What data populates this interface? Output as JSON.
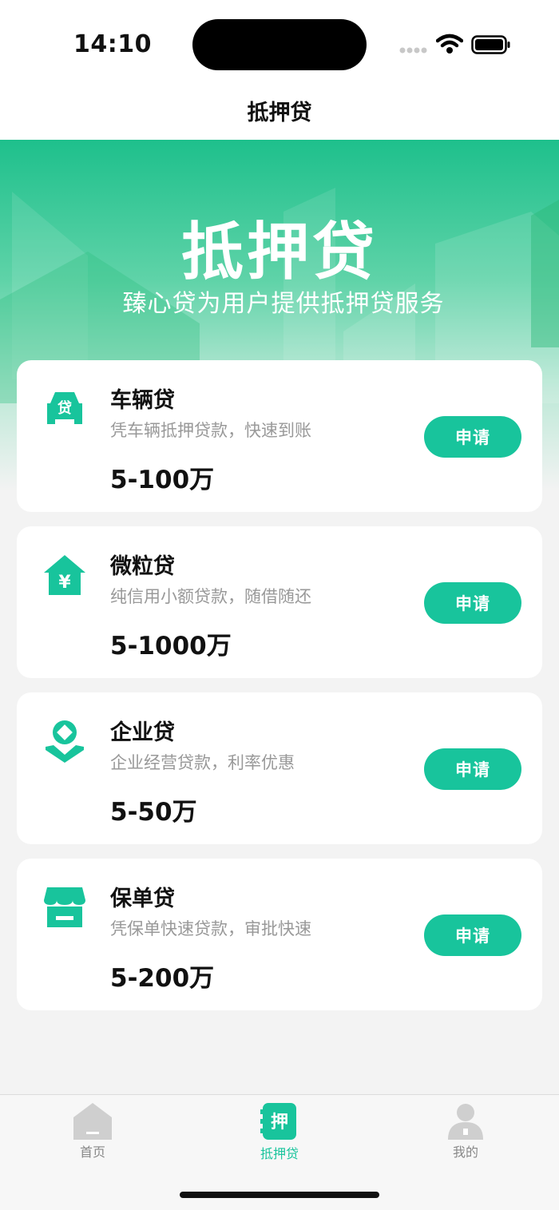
{
  "status_bar": {
    "time": "14:10"
  },
  "nav": {
    "title": "抵押贷"
  },
  "hero": {
    "title": "抵押贷",
    "subtitle": "臻心贷为用户提供抵押贷服务"
  },
  "products": [
    {
      "name": "车辆贷",
      "desc": "凭车辆抵押贷款，快速到账",
      "amount": "5-100万",
      "button": "申请",
      "icon": "car-loan-icon",
      "icon_text": "贷"
    },
    {
      "name": "微粒贷",
      "desc": "纯信用小额贷款，随借随还",
      "amount": "5-1000万",
      "button": "申请",
      "icon": "house-yen-icon",
      "icon_text": "¥"
    },
    {
      "name": "企业贷",
      "desc": "企业经营贷款，利率优惠",
      "amount": "5-50万",
      "button": "申请",
      "icon": "hand-coin-icon"
    },
    {
      "name": "保单贷",
      "desc": "凭保单快速贷款，审批快速",
      "amount": "5-200万",
      "button": "申请",
      "icon": "store-icon"
    }
  ],
  "tabs": [
    {
      "label": "首页",
      "icon": "home-icon",
      "active": false
    },
    {
      "label": "抵押贷",
      "icon": "mortgage-icon",
      "icon_text": "押",
      "active": true
    },
    {
      "label": "我的",
      "icon": "profile-icon",
      "active": false
    }
  ],
  "colors": {
    "accent": "#18c49c",
    "hero_top": "#1ec08c",
    "inactive": "#888888"
  }
}
